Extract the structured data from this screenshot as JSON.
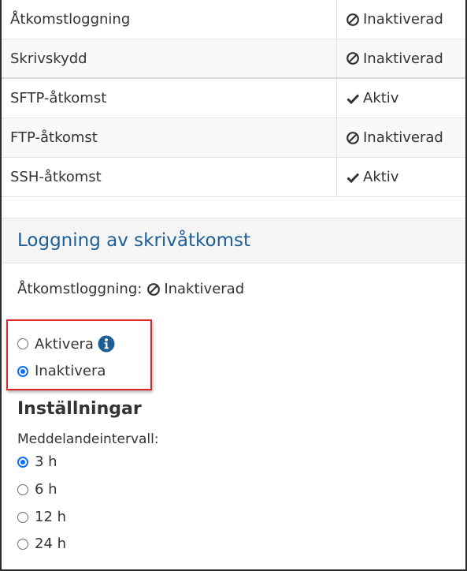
{
  "table": {
    "rows": [
      {
        "name": "Åtkomstloggning",
        "status": "Inaktiverad",
        "icon": "disabled-icon"
      },
      {
        "name": "Skrivskydd",
        "status": "Inaktiverad",
        "icon": "disabled-icon"
      },
      {
        "name": "SFTP-åtkomst",
        "status": "Aktiv",
        "icon": "check-icon"
      },
      {
        "name": "FTP-åtkomst",
        "status": "Inaktiverad",
        "icon": "disabled-icon"
      },
      {
        "name": "SSH-åtkomst",
        "status": "Aktiv",
        "icon": "check-icon"
      }
    ]
  },
  "panel": {
    "title": "Loggning av skrivåtkomst",
    "status_label": "Åtkomstloggning:",
    "status_value": "Inaktiverad",
    "options": [
      {
        "label": "Aktivera",
        "checked": false
      },
      {
        "label": "Inaktivera",
        "checked": true
      }
    ],
    "settings_title": "Inställningar",
    "interval_label": "Meddelandeintervall:",
    "intervals": [
      {
        "label": "3 h",
        "checked": true
      },
      {
        "label": "6 h",
        "checked": false
      },
      {
        "label": "12 h",
        "checked": false
      },
      {
        "label": "24 h",
        "checked": false
      }
    ]
  },
  "colors": {
    "accent": "#1d5e96",
    "radio_checked": "#0d6efd",
    "highlight": "#d9262b"
  }
}
